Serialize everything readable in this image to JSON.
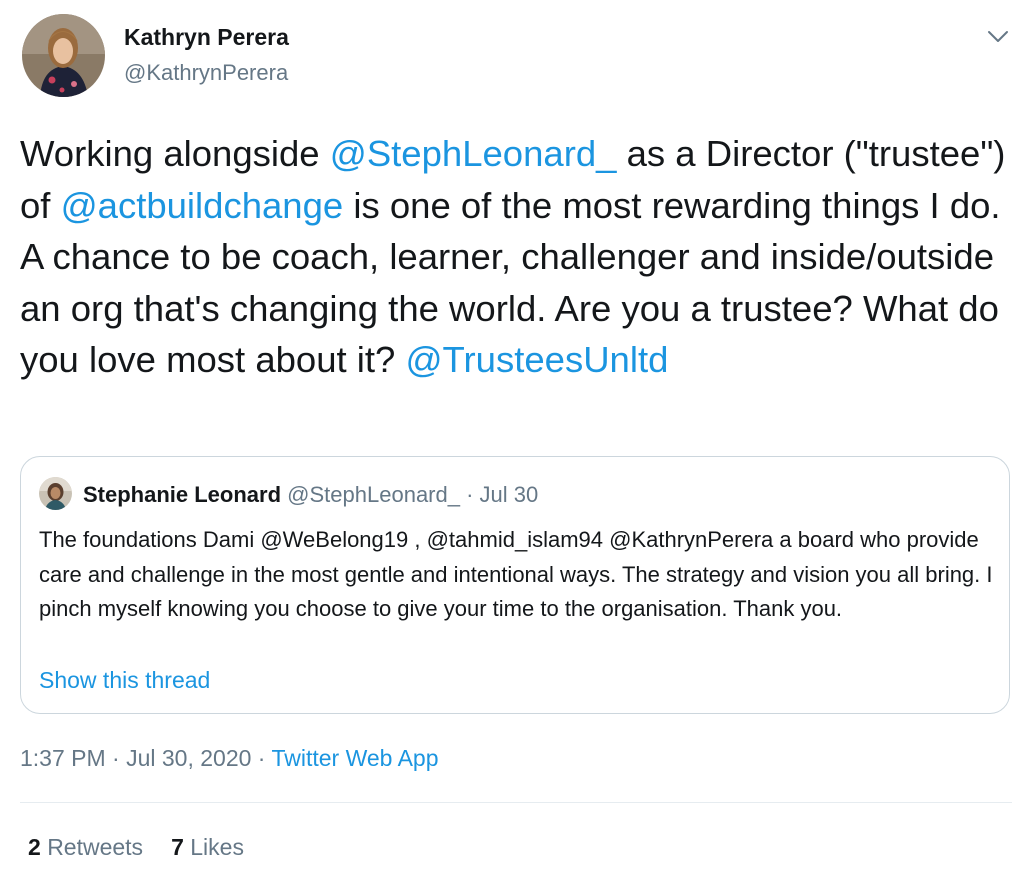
{
  "author": {
    "name": "Kathryn Perera",
    "handle": "@KathrynPerera"
  },
  "tweet": {
    "segments": [
      {
        "text": "Working alongside ",
        "type": "text"
      },
      {
        "text": "@StephLeonard_",
        "type": "mention"
      },
      {
        "text": " as a Director (\"trustee\") of ",
        "type": "text"
      },
      {
        "text": "@actbuildchange",
        "type": "mention"
      },
      {
        "text": " is one of the most rewarding things I do. A chance to be coach, learner, challenger and inside/outside an org that's changing the world. Are you a trustee? What do you love most about it? ",
        "type": "text"
      },
      {
        "text": "@TrusteesUnltd",
        "type": "mention"
      }
    ]
  },
  "quoted_tweet": {
    "name": "Stephanie Leonard",
    "handle": "@StephLeonard_",
    "separator": " · ",
    "date": "Jul 30",
    "text": "The foundations Dami @WeBelong19 , @tahmid_islam94 @KathrynPerera a board who provide care and challenge in the most gentle and intentional ways. The strategy and vision you all bring. I pinch myself knowing you choose to give your time to the organisation. Thank you.",
    "show_thread": "Show this thread"
  },
  "meta": {
    "timestamp": "1:37 PM · Jul 30, 2020",
    "separator": " · ",
    "source": "Twitter Web App"
  },
  "stats": {
    "retweets_count": "2",
    "retweets_label": "Retweets",
    "likes_count": "7",
    "likes_label": "Likes"
  },
  "icons": {
    "caret": "chevron-down-icon"
  },
  "colors": {
    "link": "#1b95e0",
    "secondary_text": "#657786",
    "primary_text": "#14171a",
    "border": "#ccd6dd",
    "divider": "#e6ecf0"
  }
}
